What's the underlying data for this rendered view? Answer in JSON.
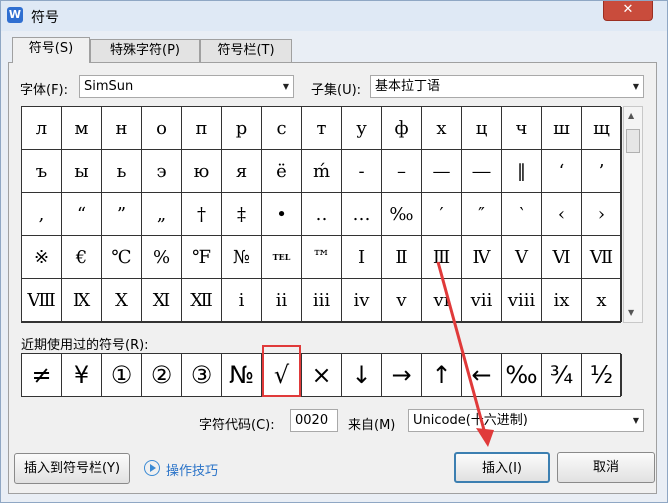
{
  "window": {
    "title": "符号",
    "close_label": "✕"
  },
  "tabs": [
    {
      "label": "符号(S)",
      "active": true
    },
    {
      "label": "特殊字符(P)",
      "active": false
    },
    {
      "label": "符号栏(T)",
      "active": false
    }
  ],
  "font": {
    "label": "字体(F):",
    "value": "SimSun"
  },
  "subset": {
    "label": "子集(U):",
    "value": "基本拉丁语"
  },
  "grid_rows": [
    [
      "л",
      "м",
      "н",
      "о",
      "п",
      "р",
      "с",
      "т",
      "у",
      "ф",
      "х",
      "ц",
      "ч",
      "ш",
      "щ"
    ],
    [
      "ъ",
      "ы",
      "ь",
      "э",
      "ю",
      "я",
      "ё",
      "ḿ",
      "-",
      "–",
      "—",
      "―",
      "‖",
      "‘",
      "’"
    ],
    [
      ",",
      "“",
      "”",
      "„",
      "†",
      "‡",
      "•",
      "‥",
      "…",
      "‰",
      "′",
      "″",
      "‵",
      "‹",
      "›"
    ],
    [
      "※",
      "€",
      "℃",
      "%",
      "℉",
      "№",
      "TEL",
      "™",
      "Ⅰ",
      "Ⅱ",
      "Ⅲ",
      "Ⅳ",
      "Ⅴ",
      "Ⅵ",
      "Ⅶ"
    ],
    [
      "Ⅷ",
      "Ⅸ",
      "Ⅹ",
      "Ⅺ",
      "Ⅻ",
      "ⅰ",
      "ⅱ",
      "ⅲ",
      "ⅳ",
      "ⅴ",
      "ⅵ",
      "ⅶ",
      "ⅷ",
      "ⅸ",
      "ⅹ"
    ]
  ],
  "recent": {
    "label": "近期使用过的符号(R):",
    "symbols": [
      "≠",
      "¥",
      "①",
      "②",
      "③",
      "№",
      "√",
      "×",
      "↓",
      "→",
      "↑",
      "←",
      "‰",
      "¾",
      "½"
    ],
    "highlighted_index": 6
  },
  "char_code": {
    "label": "字符代码(C):",
    "value": "0020"
  },
  "from": {
    "label": "来自(M)",
    "value": "Unicode(十六进制)"
  },
  "buttons": {
    "insert_to_bar": "插入到符号栏(Y)",
    "tips": "操作技巧",
    "insert": "插入(I)",
    "cancel": "取消"
  },
  "colors": {
    "highlight": "#e03a3a",
    "link": "#2a73c8",
    "close": "#c94c3c"
  }
}
